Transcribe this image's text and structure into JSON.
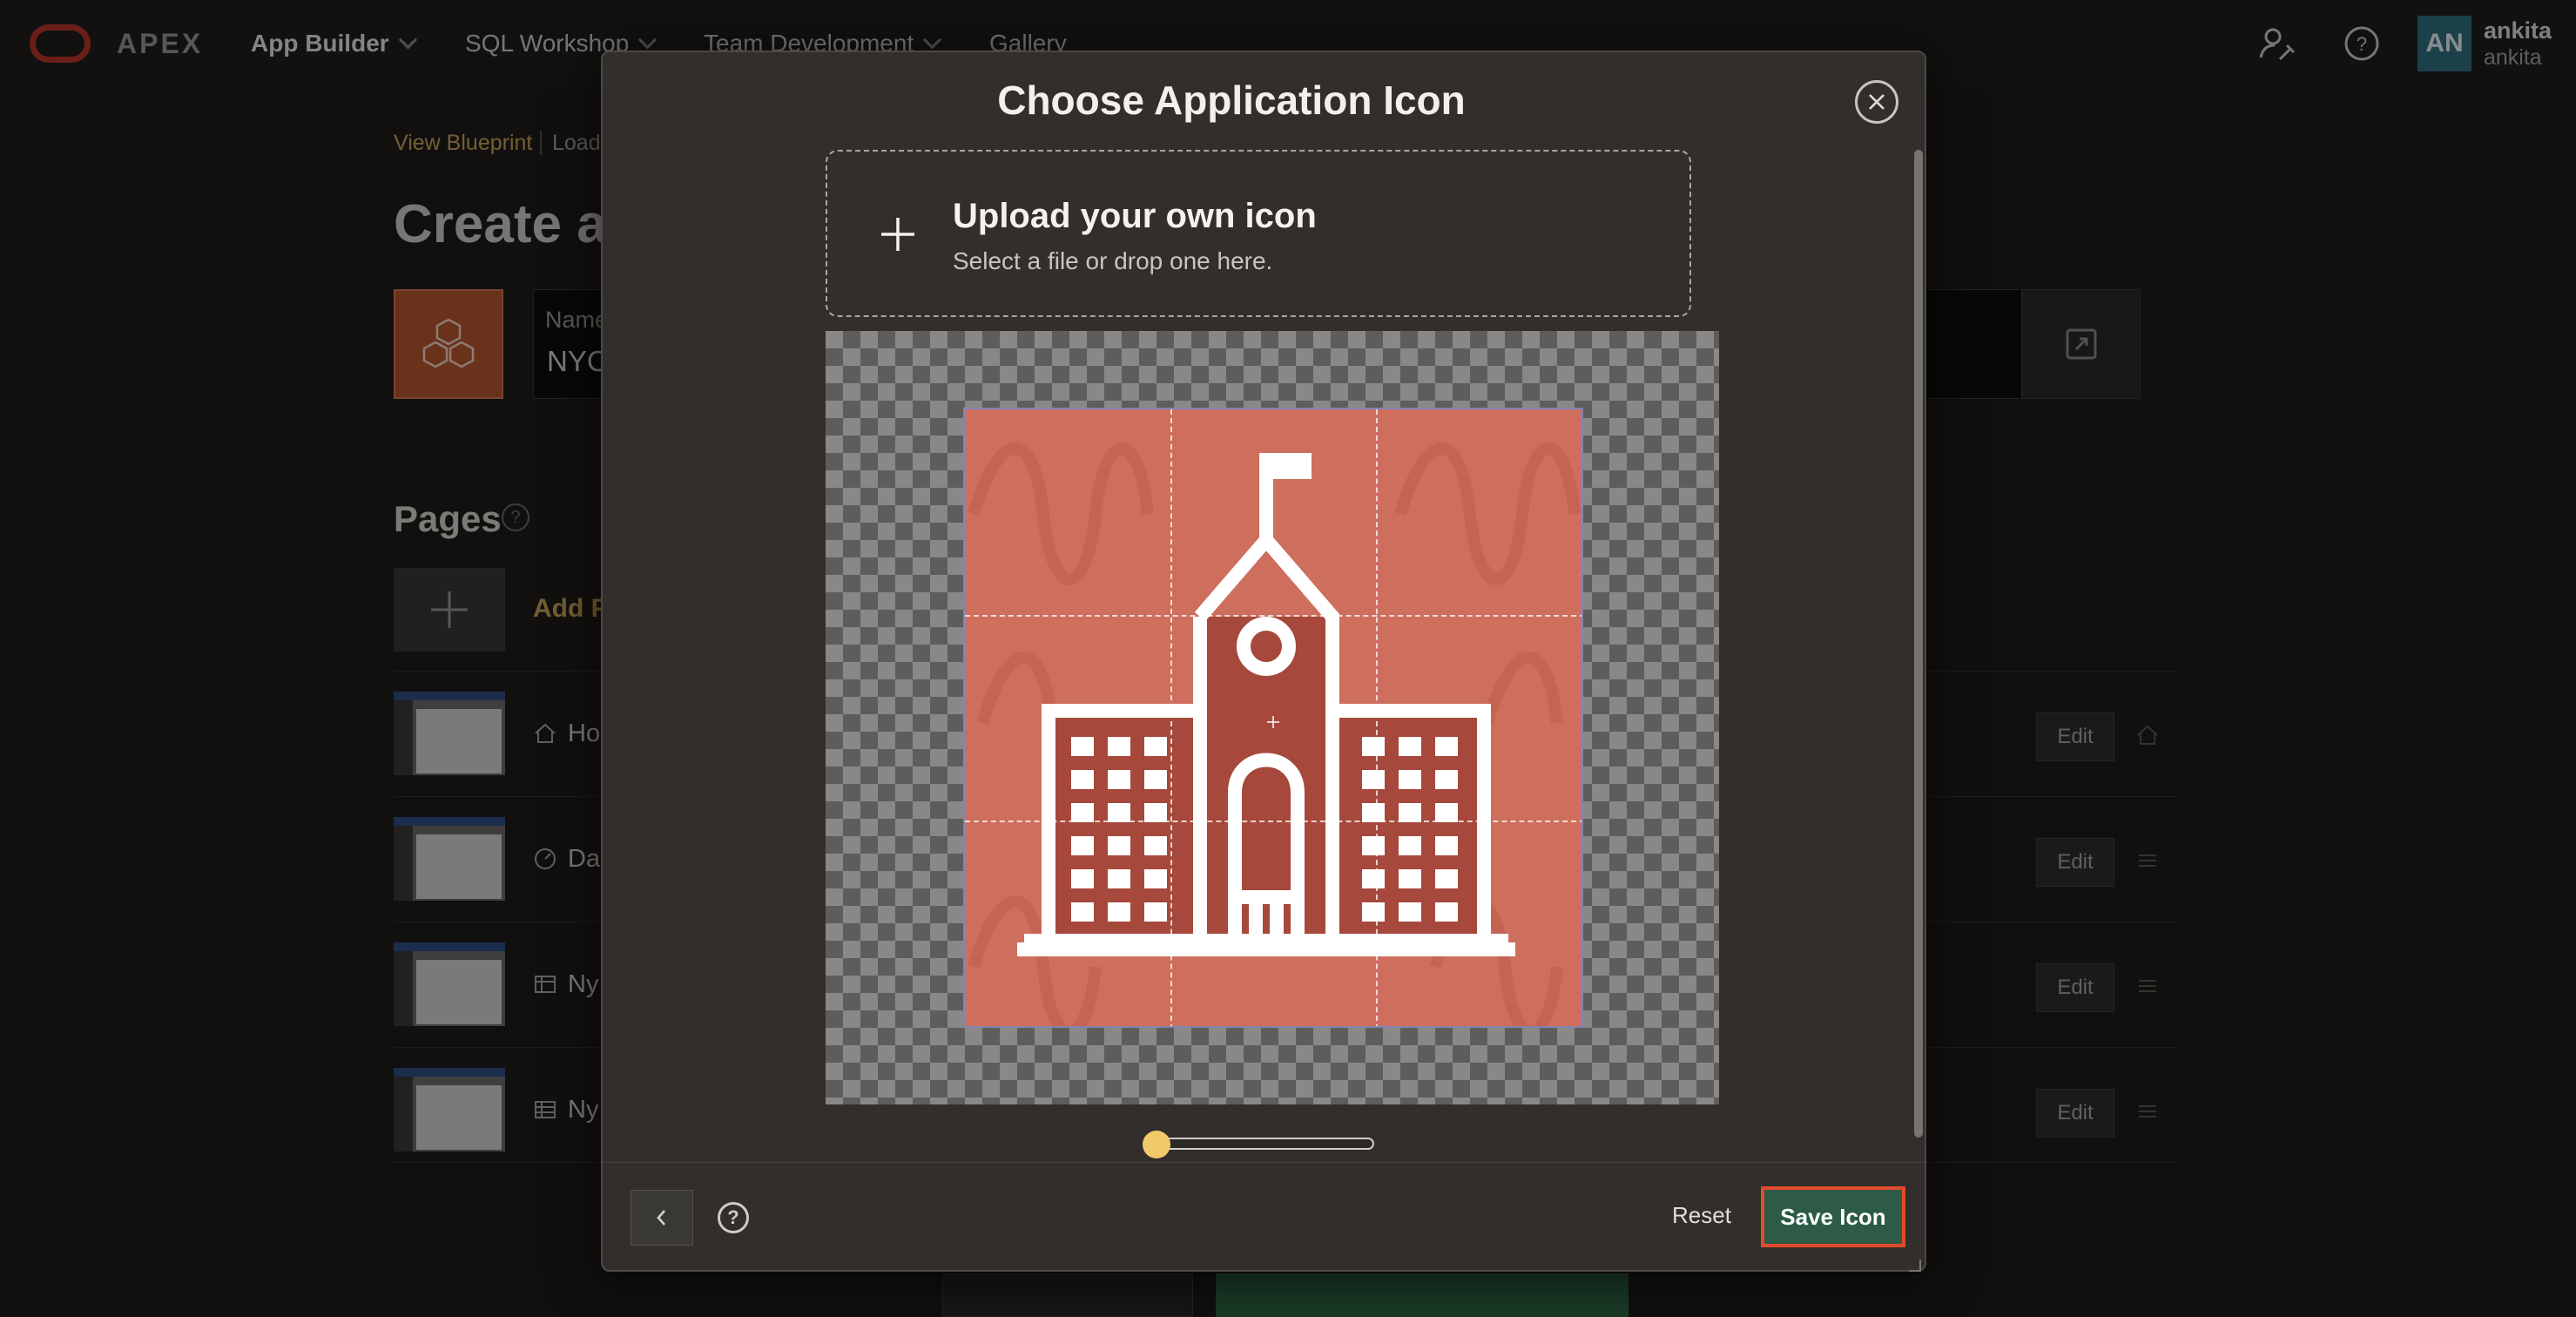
{
  "app": {
    "logo_text": "APEX",
    "nav": [
      {
        "label": "App Builder"
      },
      {
        "label": "SQL Workshop"
      },
      {
        "label": "Team Development"
      },
      {
        "label": "Gallery"
      }
    ],
    "user": {
      "initials": "AN",
      "name": "ankita",
      "workspace": "ankita"
    }
  },
  "background_page": {
    "breadcrumbs": [
      "View Blueprint",
      "Load"
    ],
    "title": "Create a",
    "name_field": {
      "label": "Name",
      "value": "NYC"
    },
    "pages_heading": "Pages",
    "add_page_label": "Add P",
    "pages": [
      {
        "title": "Ho",
        "icon": "home-icon",
        "edit_label": "Edit"
      },
      {
        "title": "Das",
        "icon": "dashboard-icon",
        "edit_label": "Edit"
      },
      {
        "title": "Ny",
        "icon": "report-icon",
        "edit_label": "Edit"
      },
      {
        "title": "Ny",
        "icon": "grid-icon",
        "edit_label": "Edit"
      }
    ]
  },
  "dialog": {
    "title": "Choose Application Icon",
    "upload": {
      "title": "Upload your own icon",
      "subtitle": "Select a file or drop one here."
    },
    "preview": {
      "icon": "school-building-icon",
      "background_color": "#ce6e5d"
    },
    "zoom": {
      "value": 0.0
    },
    "footer": {
      "reset_label": "Reset",
      "save_label": "Save Icon"
    }
  },
  "colors": {
    "accent_gold": "#c9a45a",
    "save_green": "#2d5b45",
    "highlight_red": "#e24a2d",
    "oracle_red": "#b9352a"
  }
}
